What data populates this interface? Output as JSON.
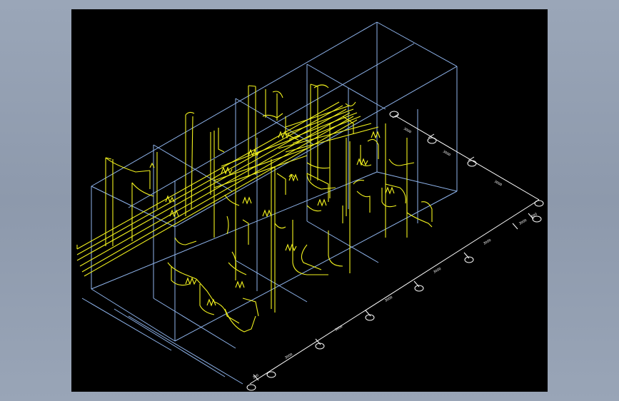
{
  "drawing": {
    "background": "#000000",
    "grid_color": "#8fb4ec",
    "pipe_color": "#f2f21e",
    "dimension_color": "#ffffff"
  },
  "dimensions": {
    "row_bottom": [
      "300",
      "3000",
      "3000",
      "3000",
      "3000",
      "3000",
      "3000",
      "600"
    ],
    "row_right": [
      "3000",
      "3000",
      "3000"
    ]
  }
}
